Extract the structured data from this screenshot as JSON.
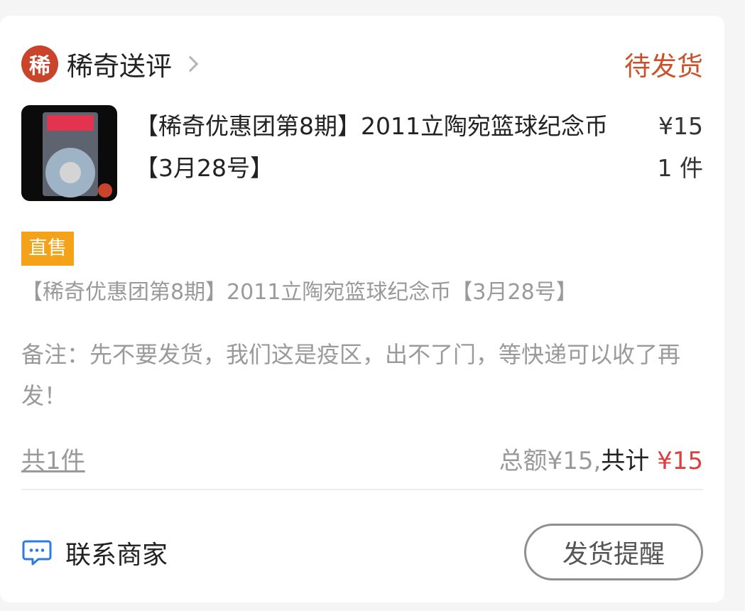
{
  "shop": {
    "logo_char": "稀",
    "name": "稀奇送评",
    "status": "待发货"
  },
  "product": {
    "title": "【稀奇优惠团第8期】2011立陶宛篮球纪念币【3月28号】",
    "price": "¥15",
    "quantity": "1 件",
    "thumbnail_icon": "coin-slab-image"
  },
  "tag": "直售",
  "description": "【稀奇优惠团第8期】2011立陶宛篮球纪念币【3月28号】",
  "remark": "备注：先不要发货，我们这是疫区，出不了门，等快递可以收了再发！",
  "summary": {
    "count": "共1件",
    "amount": "总额¥15,",
    "total_label": "共计",
    "total_value": "¥15"
  },
  "actions": {
    "contact": "联系商家",
    "remind": "发货提醒"
  },
  "colors": {
    "status": "#c9522a",
    "tag_bg": "#f3a21a",
    "total": "#e03e3e",
    "chat_icon": "#2d7be0"
  }
}
